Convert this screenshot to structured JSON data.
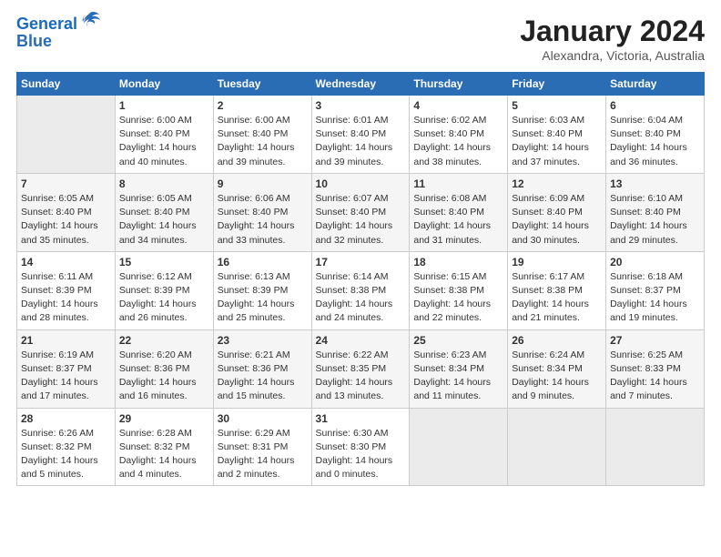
{
  "logo": {
    "line1": "General",
    "line2": "Blue"
  },
  "title": "January 2024",
  "subtitle": "Alexandra, Victoria, Australia",
  "header": {
    "days": [
      "Sunday",
      "Monday",
      "Tuesday",
      "Wednesday",
      "Thursday",
      "Friday",
      "Saturday"
    ]
  },
  "weeks": [
    {
      "cells": [
        {
          "date": "",
          "content": "",
          "empty": true
        },
        {
          "date": "1",
          "content": "Sunrise: 6:00 AM\nSunset: 8:40 PM\nDaylight: 14 hours\nand 40 minutes."
        },
        {
          "date": "2",
          "content": "Sunrise: 6:00 AM\nSunset: 8:40 PM\nDaylight: 14 hours\nand 39 minutes."
        },
        {
          "date": "3",
          "content": "Sunrise: 6:01 AM\nSunset: 8:40 PM\nDaylight: 14 hours\nand 39 minutes."
        },
        {
          "date": "4",
          "content": "Sunrise: 6:02 AM\nSunset: 8:40 PM\nDaylight: 14 hours\nand 38 minutes."
        },
        {
          "date": "5",
          "content": "Sunrise: 6:03 AM\nSunset: 8:40 PM\nDaylight: 14 hours\nand 37 minutes."
        },
        {
          "date": "6",
          "content": "Sunrise: 6:04 AM\nSunset: 8:40 PM\nDaylight: 14 hours\nand 36 minutes."
        }
      ]
    },
    {
      "cells": [
        {
          "date": "7",
          "content": "Sunrise: 6:05 AM\nSunset: 8:40 PM\nDaylight: 14 hours\nand 35 minutes."
        },
        {
          "date": "8",
          "content": "Sunrise: 6:05 AM\nSunset: 8:40 PM\nDaylight: 14 hours\nand 34 minutes."
        },
        {
          "date": "9",
          "content": "Sunrise: 6:06 AM\nSunset: 8:40 PM\nDaylight: 14 hours\nand 33 minutes."
        },
        {
          "date": "10",
          "content": "Sunrise: 6:07 AM\nSunset: 8:40 PM\nDaylight: 14 hours\nand 32 minutes."
        },
        {
          "date": "11",
          "content": "Sunrise: 6:08 AM\nSunset: 8:40 PM\nDaylight: 14 hours\nand 31 minutes."
        },
        {
          "date": "12",
          "content": "Sunrise: 6:09 AM\nSunset: 8:40 PM\nDaylight: 14 hours\nand 30 minutes."
        },
        {
          "date": "13",
          "content": "Sunrise: 6:10 AM\nSunset: 8:40 PM\nDaylight: 14 hours\nand 29 minutes."
        }
      ]
    },
    {
      "cells": [
        {
          "date": "14",
          "content": "Sunrise: 6:11 AM\nSunset: 8:39 PM\nDaylight: 14 hours\nand 28 minutes."
        },
        {
          "date": "15",
          "content": "Sunrise: 6:12 AM\nSunset: 8:39 PM\nDaylight: 14 hours\nand 26 minutes."
        },
        {
          "date": "16",
          "content": "Sunrise: 6:13 AM\nSunset: 8:39 PM\nDaylight: 14 hours\nand 25 minutes."
        },
        {
          "date": "17",
          "content": "Sunrise: 6:14 AM\nSunset: 8:38 PM\nDaylight: 14 hours\nand 24 minutes."
        },
        {
          "date": "18",
          "content": "Sunrise: 6:15 AM\nSunset: 8:38 PM\nDaylight: 14 hours\nand 22 minutes."
        },
        {
          "date": "19",
          "content": "Sunrise: 6:17 AM\nSunset: 8:38 PM\nDaylight: 14 hours\nand 21 minutes."
        },
        {
          "date": "20",
          "content": "Sunrise: 6:18 AM\nSunset: 8:37 PM\nDaylight: 14 hours\nand 19 minutes."
        }
      ]
    },
    {
      "cells": [
        {
          "date": "21",
          "content": "Sunrise: 6:19 AM\nSunset: 8:37 PM\nDaylight: 14 hours\nand 17 minutes."
        },
        {
          "date": "22",
          "content": "Sunrise: 6:20 AM\nSunset: 8:36 PM\nDaylight: 14 hours\nand 16 minutes."
        },
        {
          "date": "23",
          "content": "Sunrise: 6:21 AM\nSunset: 8:36 PM\nDaylight: 14 hours\nand 15 minutes."
        },
        {
          "date": "24",
          "content": "Sunrise: 6:22 AM\nSunset: 8:35 PM\nDaylight: 14 hours\nand 13 minutes."
        },
        {
          "date": "25",
          "content": "Sunrise: 6:23 AM\nSunset: 8:34 PM\nDaylight: 14 hours\nand 11 minutes."
        },
        {
          "date": "26",
          "content": "Sunrise: 6:24 AM\nSunset: 8:34 PM\nDaylight: 14 hours\nand 9 minutes."
        },
        {
          "date": "27",
          "content": "Sunrise: 6:25 AM\nSunset: 8:33 PM\nDaylight: 14 hours\nand 7 minutes."
        }
      ]
    },
    {
      "cells": [
        {
          "date": "28",
          "content": "Sunrise: 6:26 AM\nSunset: 8:32 PM\nDaylight: 14 hours\nand 5 minutes."
        },
        {
          "date": "29",
          "content": "Sunrise: 6:28 AM\nSunset: 8:32 PM\nDaylight: 14 hours\nand 4 minutes."
        },
        {
          "date": "30",
          "content": "Sunrise: 6:29 AM\nSunset: 8:31 PM\nDaylight: 14 hours\nand 2 minutes."
        },
        {
          "date": "31",
          "content": "Sunrise: 6:30 AM\nSunset: 8:30 PM\nDaylight: 14 hours\nand 0 minutes."
        },
        {
          "date": "",
          "content": "",
          "empty": true
        },
        {
          "date": "",
          "content": "",
          "empty": true
        },
        {
          "date": "",
          "content": "",
          "empty": true
        }
      ]
    }
  ]
}
